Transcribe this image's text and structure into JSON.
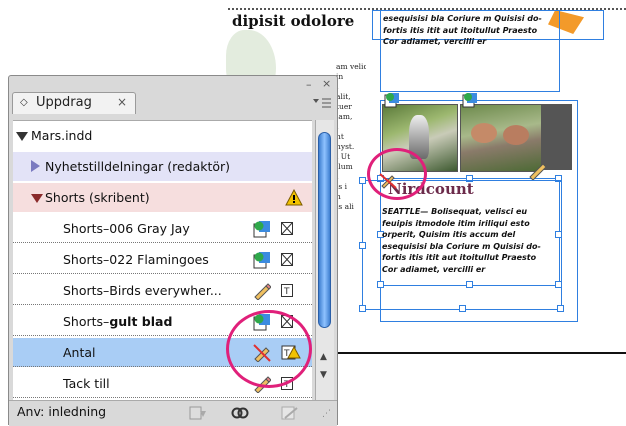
{
  "document": {
    "heading": "dipisit odolore",
    "left_text_lines": [
      "am veliquamet nonsecte in",
      "in",
      "i",
      "alit,",
      "tuer",
      "lam,",
      "i",
      "nt",
      "hyst.",
      "l Ut",
      "llum",
      "i",
      "is i",
      "n",
      "is ali"
    ],
    "story_top_lines": [
      "esequisisi bla Coriure m Quisisi do-",
      "fortis itis itit aut itoitullut Praesto",
      "Cor adiamet, vercilli er"
    ],
    "caption_title": "Nirdcount",
    "story_bottom_lines": [
      "SEATTLE— Bolisequat, velisci eu",
      "feuipis itmodole itim iriliqui esto",
      "orperit, Quisim itis accum del",
      "esequisisi bla Coriure m Quisisi do-",
      "fortis itis itit aut itoitullut Praesto",
      "Cor adiamet, vercilli er"
    ]
  },
  "panel": {
    "tab_label": "Uppdrag",
    "tab_close": "×",
    "window_controls": [
      "–",
      "×"
    ],
    "menu_icon": "panel-menu-icon",
    "rows": [
      {
        "label": "Mars.indd",
        "level": 0,
        "expanded": true,
        "bg": "#ffffff",
        "icons": []
      },
      {
        "label": "Nyhetstilldelningar (redaktör)",
        "level": 1,
        "expanded": false,
        "bg": "#e3e3f7",
        "icons": []
      },
      {
        "label": "Shorts (skribent)",
        "level": 1,
        "expanded": true,
        "bg": "#f6dede",
        "icons": [
          "warning-icon"
        ]
      },
      {
        "label": "Shorts–006 Gray Jay",
        "level": 2,
        "bg": "#ffffff",
        "icons": [
          "linked-content-icon",
          "graphic-frame-icon"
        ]
      },
      {
        "label": "Shorts–022 Flamingoes",
        "level": 2,
        "bg": "#ffffff",
        "icons": [
          "linked-content-icon",
          "graphic-frame-icon"
        ]
      },
      {
        "label": "Shorts–Birds everywher...",
        "level": 2,
        "bg": "#ffffff",
        "icons": [
          "pencil-icon",
          "text-frame-icon"
        ]
      },
      {
        "label_prefix": "Shorts–",
        "label_bold": "gult blad",
        "level": 2,
        "bg": "#ffffff",
        "icons": [
          "linked-content-icon",
          "graphic-frame-icon"
        ]
      },
      {
        "label": "Antal",
        "level": 2,
        "bg": "#a9cdf5",
        "selected": true,
        "icons": [
          "crossed-pencil-icon",
          "text-overset-warning-icon"
        ]
      },
      {
        "label": "Tack till",
        "level": 2,
        "bg": "#ffffff",
        "icons": [
          "pencil-icon",
          "text-frame-icon"
        ]
      }
    ],
    "status_label": "Anv: inledning",
    "status_icons": [
      "update-content-icon",
      "relink-icon",
      "edit-icon"
    ],
    "colors": {
      "selection": "#a9cdf5",
      "highlight_circle": "#e0207a",
      "frame": "#2f7fe0",
      "scroll_thumb": "#5a9ee8"
    }
  }
}
